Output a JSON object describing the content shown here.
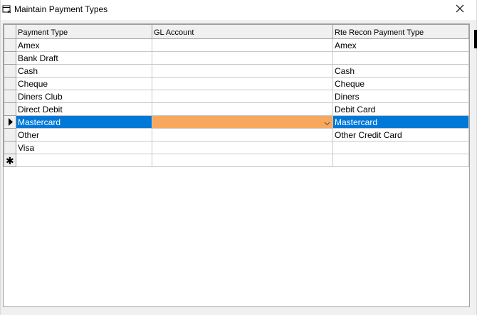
{
  "window": {
    "title": "Maintain Payment Types"
  },
  "grid": {
    "columns": [
      "Payment Type",
      "GL Account",
      "Rte Recon Payment Type"
    ],
    "rows": [
      {
        "payment_type": "Amex",
        "gl_account": "",
        "recon_type": "Amex"
      },
      {
        "payment_type": "Bank Draft",
        "gl_account": "",
        "recon_type": ""
      },
      {
        "payment_type": "Cash",
        "gl_account": "",
        "recon_type": "Cash"
      },
      {
        "payment_type": "Cheque",
        "gl_account": "",
        "recon_type": "Cheque"
      },
      {
        "payment_type": "Diners Club",
        "gl_account": "",
        "recon_type": "Diners"
      },
      {
        "payment_type": "Direct Debit",
        "gl_account": "",
        "recon_type": "Debit Card"
      },
      {
        "payment_type": "Mastercard",
        "gl_account": "",
        "recon_type": "Mastercard"
      },
      {
        "payment_type": "Other",
        "gl_account": "",
        "recon_type": "Other Credit Card"
      },
      {
        "payment_type": "Visa",
        "gl_account": "",
        "recon_type": ""
      }
    ],
    "selected_row_index": 6,
    "new_row_marker": "✱"
  },
  "colors": {
    "selection": "#0078d7",
    "edit_cell": "#f7a85c"
  },
  "icons": {
    "title": "form-icon",
    "close": "close-icon",
    "current_row": "row-pointer-icon",
    "new_row": "new-row-icon",
    "dropdown": "chevron-down-icon"
  }
}
